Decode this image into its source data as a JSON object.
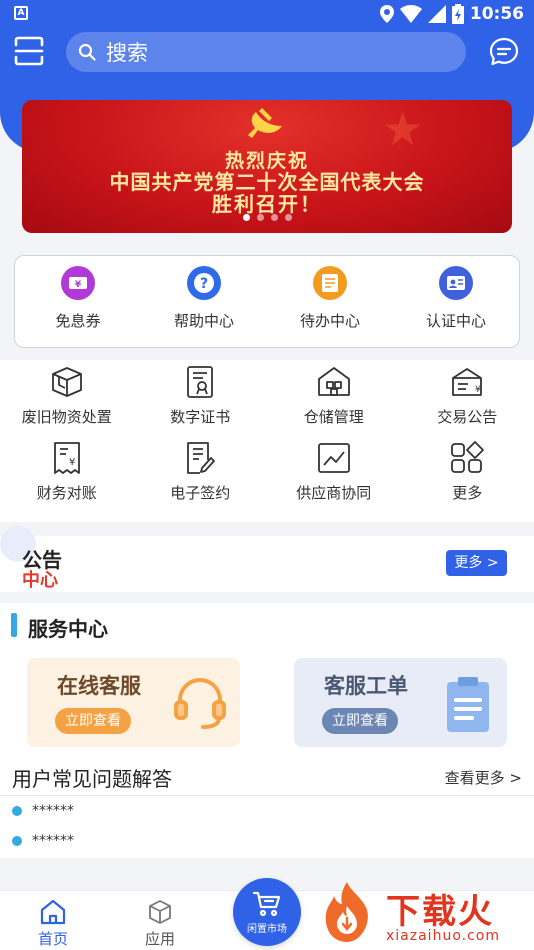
{
  "status_bar": {
    "time": "10:56",
    "app_icon": "A"
  },
  "header": {
    "search_placeholder": "搜索"
  },
  "banner": {
    "line1": "热烈庆祝",
    "line2": "中国共产党第二十次全国代表大会",
    "line3": "胜利召开！",
    "dot_count": 4,
    "active_dot": 1
  },
  "quick_actions": [
    {
      "label": "免息券",
      "icon": "coupon-icon",
      "color": "#b13ad6"
    },
    {
      "label": "帮助中心",
      "icon": "help-icon",
      "color": "#2f6be8"
    },
    {
      "label": "待办中心",
      "icon": "todo-icon",
      "color": "#f39b1f"
    },
    {
      "label": "认证中心",
      "icon": "certification-icon",
      "color": "#3f62dc"
    }
  ],
  "grid_items": [
    {
      "label": "废旧物资处置",
      "icon": "box-icon"
    },
    {
      "label": "数字证书",
      "icon": "certificate-icon"
    },
    {
      "label": "仓储管理",
      "icon": "warehouse-icon"
    },
    {
      "label": "交易公告",
      "icon": "announcement-icon"
    },
    {
      "label": "财务对账",
      "icon": "finance-icon"
    },
    {
      "label": "电子签约",
      "icon": "e-sign-icon"
    },
    {
      "label": "供应商协同",
      "icon": "chart-icon"
    },
    {
      "label": "更多",
      "icon": "more-grid-icon"
    }
  ],
  "notice": {
    "title_top": "公告",
    "title_bottom": "中心",
    "more": "更多 >"
  },
  "service": {
    "title": "服务中心",
    "cards": [
      {
        "title": "在线客服",
        "button": "立即查看",
        "icon": "headset-icon"
      },
      {
        "title": "客服工单",
        "button": "立即查看",
        "icon": "clipboard-icon"
      }
    ],
    "faq_title": "用户常见问题解答",
    "faq_more": "查看更多 >",
    "faq_items": [
      "******",
      "******"
    ]
  },
  "bottom_nav": {
    "home": "首页",
    "apps": "应用",
    "market": "闲置市场"
  },
  "watermark": {
    "brand": "下载火",
    "url": "xiazaihuo.com"
  },
  "colors": {
    "primary": "#2f62e6",
    "accent": "#37a7e3",
    "banner_red": "#c8141a"
  }
}
